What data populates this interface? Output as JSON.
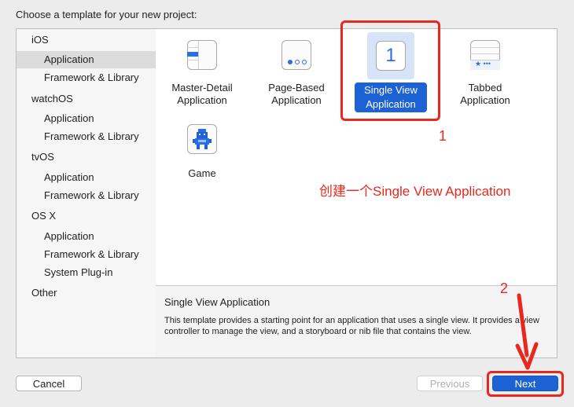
{
  "header": {
    "title": "Choose a template for your new project:"
  },
  "sidebar": {
    "groups": [
      {
        "label": "iOS",
        "items": [
          "Application",
          "Framework & Library"
        ]
      },
      {
        "label": "watchOS",
        "items": [
          "Application",
          "Framework & Library"
        ]
      },
      {
        "label": "tvOS",
        "items": [
          "Application",
          "Framework & Library"
        ]
      },
      {
        "label": "OS X",
        "items": [
          "Application",
          "Framework & Library",
          "System Plug-in"
        ]
      },
      {
        "label": "Other",
        "items": []
      }
    ],
    "selected": "iOS / Application"
  },
  "templates": [
    {
      "line1": "Master-Detail",
      "line2": "Application",
      "icon": "master-detail-icon"
    },
    {
      "line1": "Page-Based",
      "line2": "Application",
      "icon": "page-based-icon"
    },
    {
      "line1": "Single View",
      "line2": "Application",
      "icon": "single-view-icon",
      "icon_text": "1",
      "selected": true
    },
    {
      "line1": "Tabbed",
      "line2": "Application",
      "icon": "tabbed-icon"
    },
    {
      "line1": "Game",
      "line2": "",
      "icon": "game-icon"
    }
  ],
  "description": {
    "title": "Single View Application",
    "body": "This template provides a starting point for an application that uses a single view. It provides a view controller to manage the view, and a storyboard or nib file that contains the view."
  },
  "buttons": {
    "cancel": "Cancel",
    "previous": "Previous",
    "next": "Next"
  },
  "annotations": {
    "step1": "1",
    "step2": "2",
    "note": "创建一个Single View Application"
  },
  "colors": {
    "accent": "#1d62d4",
    "annotation": "#e8271f"
  }
}
